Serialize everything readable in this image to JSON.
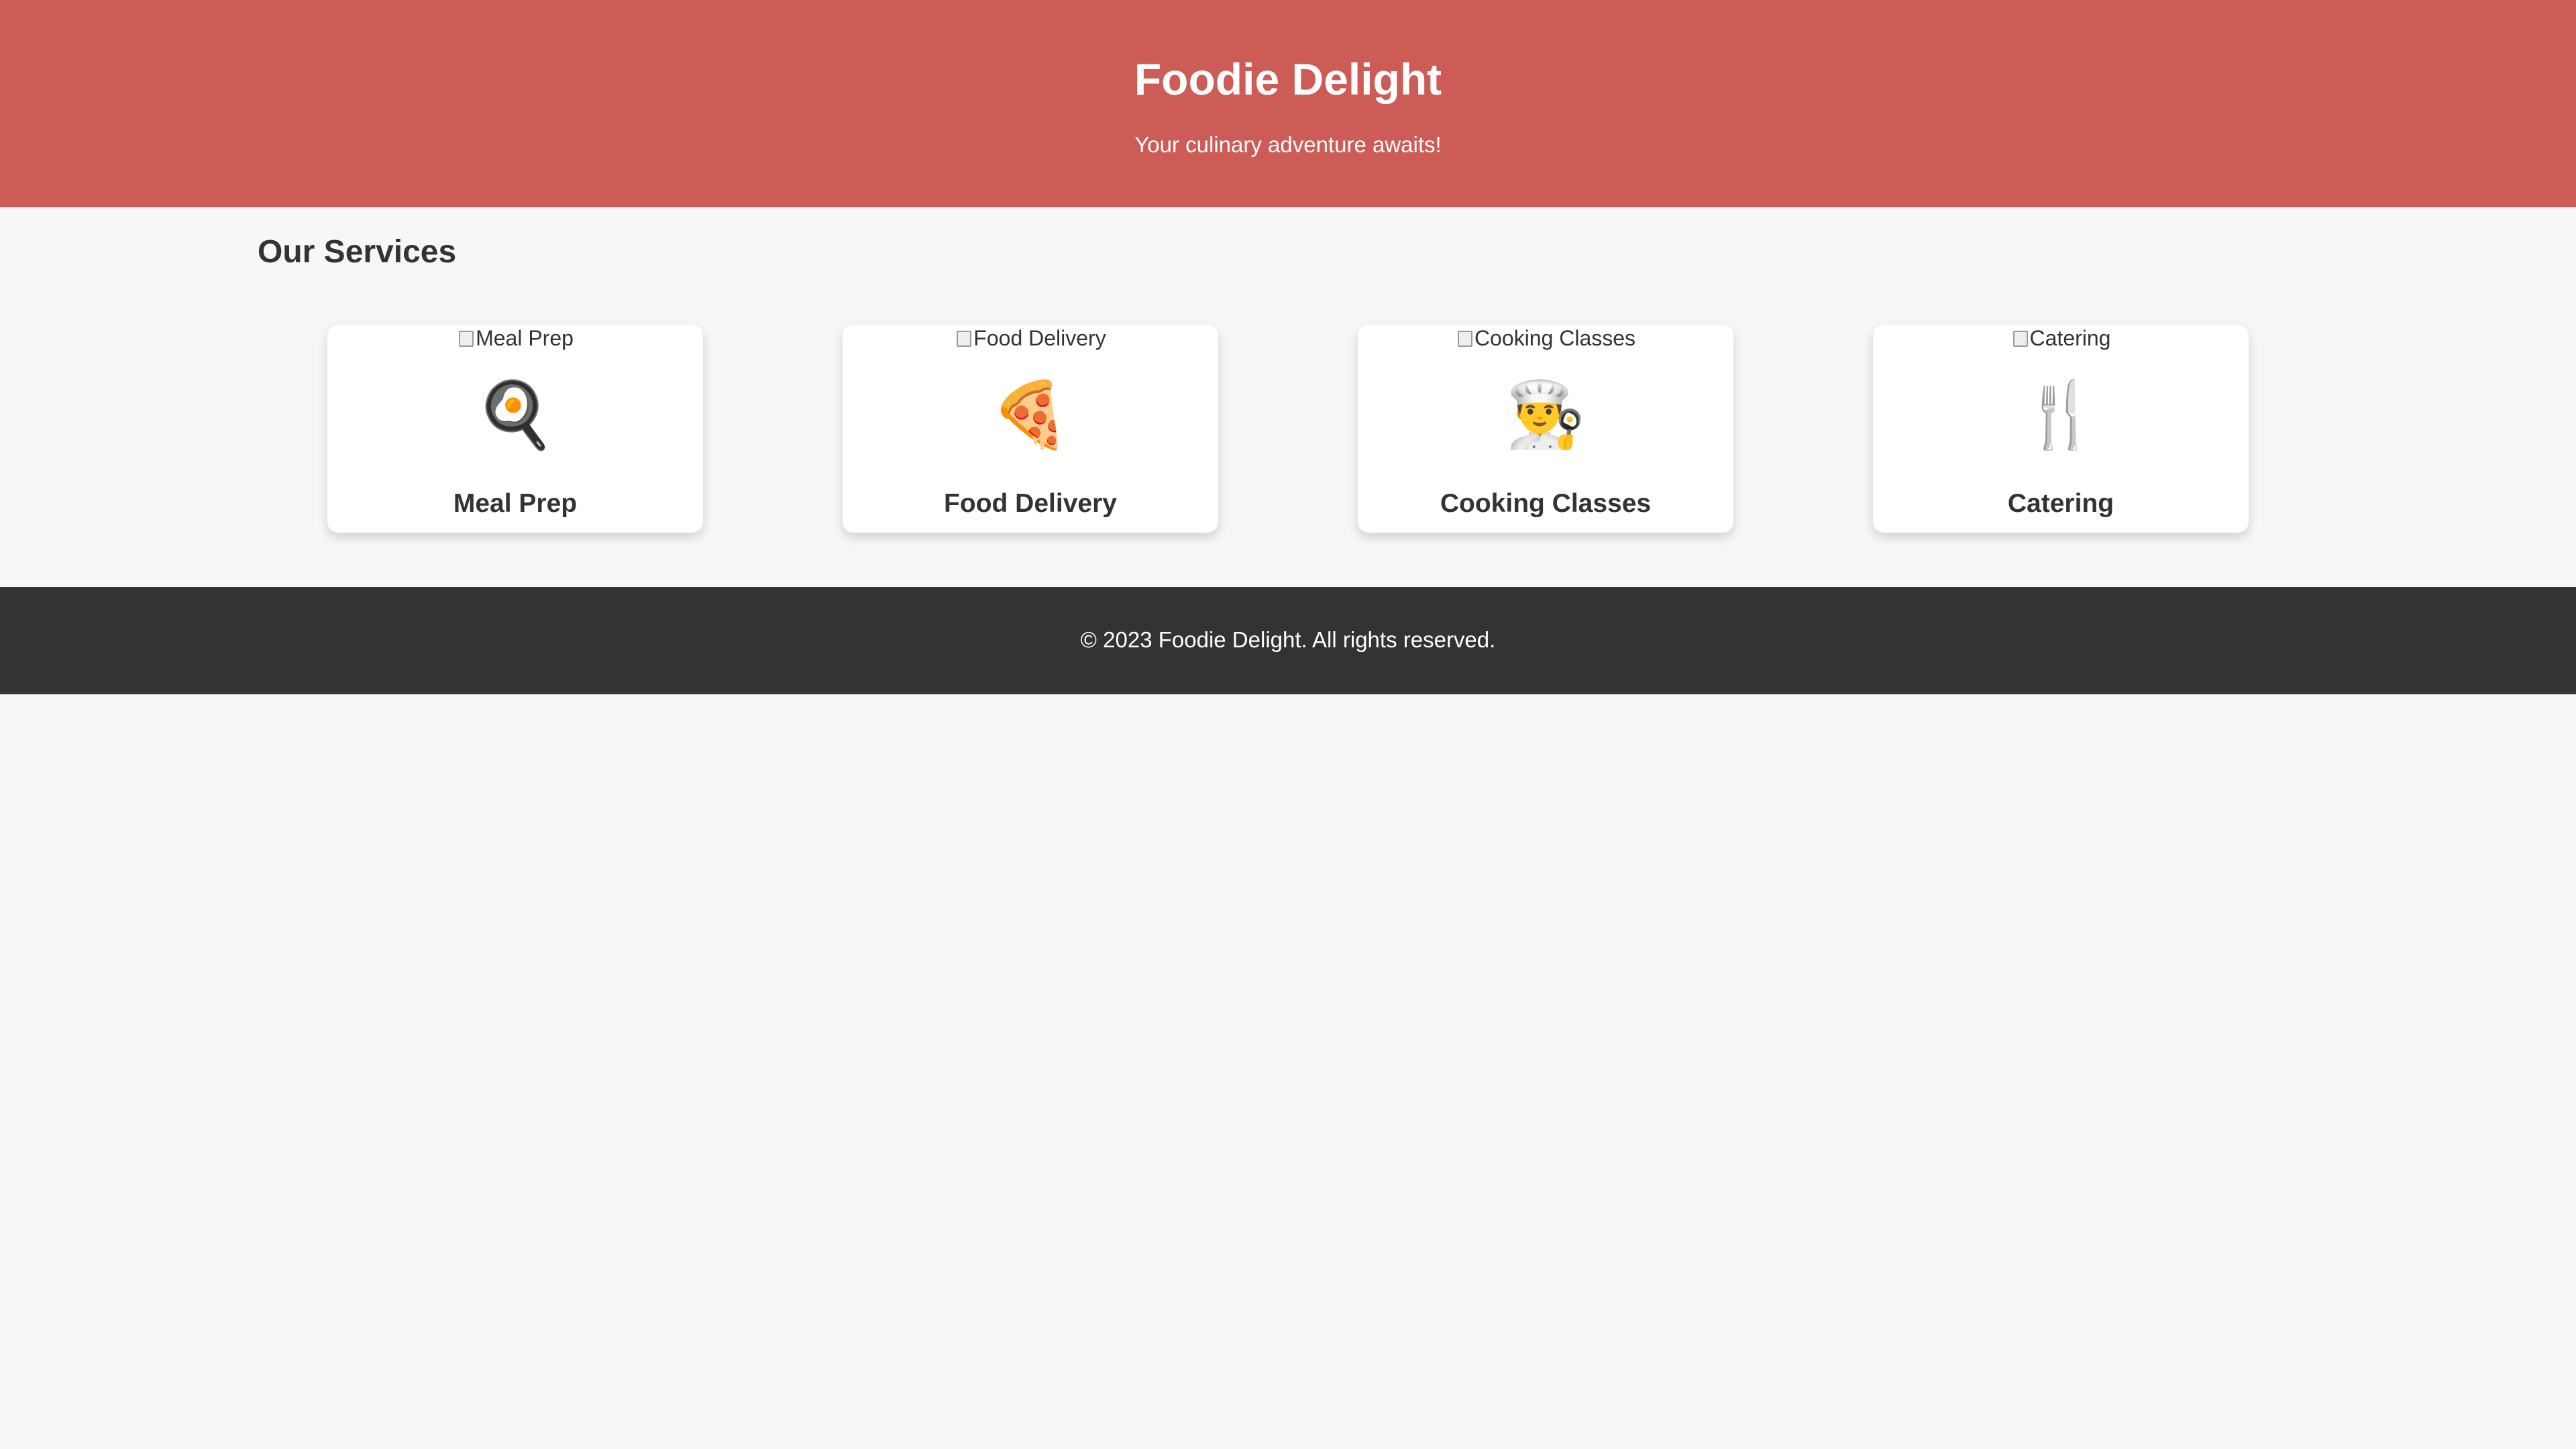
{
  "header": {
    "title": "Foodie Delight",
    "tagline": "Your culinary adventure awaits!"
  },
  "services": {
    "heading": "Our Services",
    "items": [
      {
        "alt": "Meal Prep",
        "emoji": "🍳",
        "icon_name": "frying-pan-icon",
        "name": "Meal Prep"
      },
      {
        "alt": "Food Delivery",
        "emoji": "🍕",
        "icon_name": "pizza-icon",
        "name": "Food Delivery"
      },
      {
        "alt": "Cooking Classes",
        "emoji": "👨‍🍳",
        "icon_name": "chef-icon",
        "name": "Cooking Classes"
      },
      {
        "alt": "Catering",
        "emoji": "🍴",
        "icon_name": "fork-knife-icon",
        "name": "Catering"
      }
    ]
  },
  "footer": {
    "text": "© 2023 Foodie Delight. All rights reserved."
  },
  "colors": {
    "header_bg": "#cd5c57",
    "page_bg": "#f7f7f7",
    "footer_bg": "#333333",
    "text": "#333333"
  }
}
